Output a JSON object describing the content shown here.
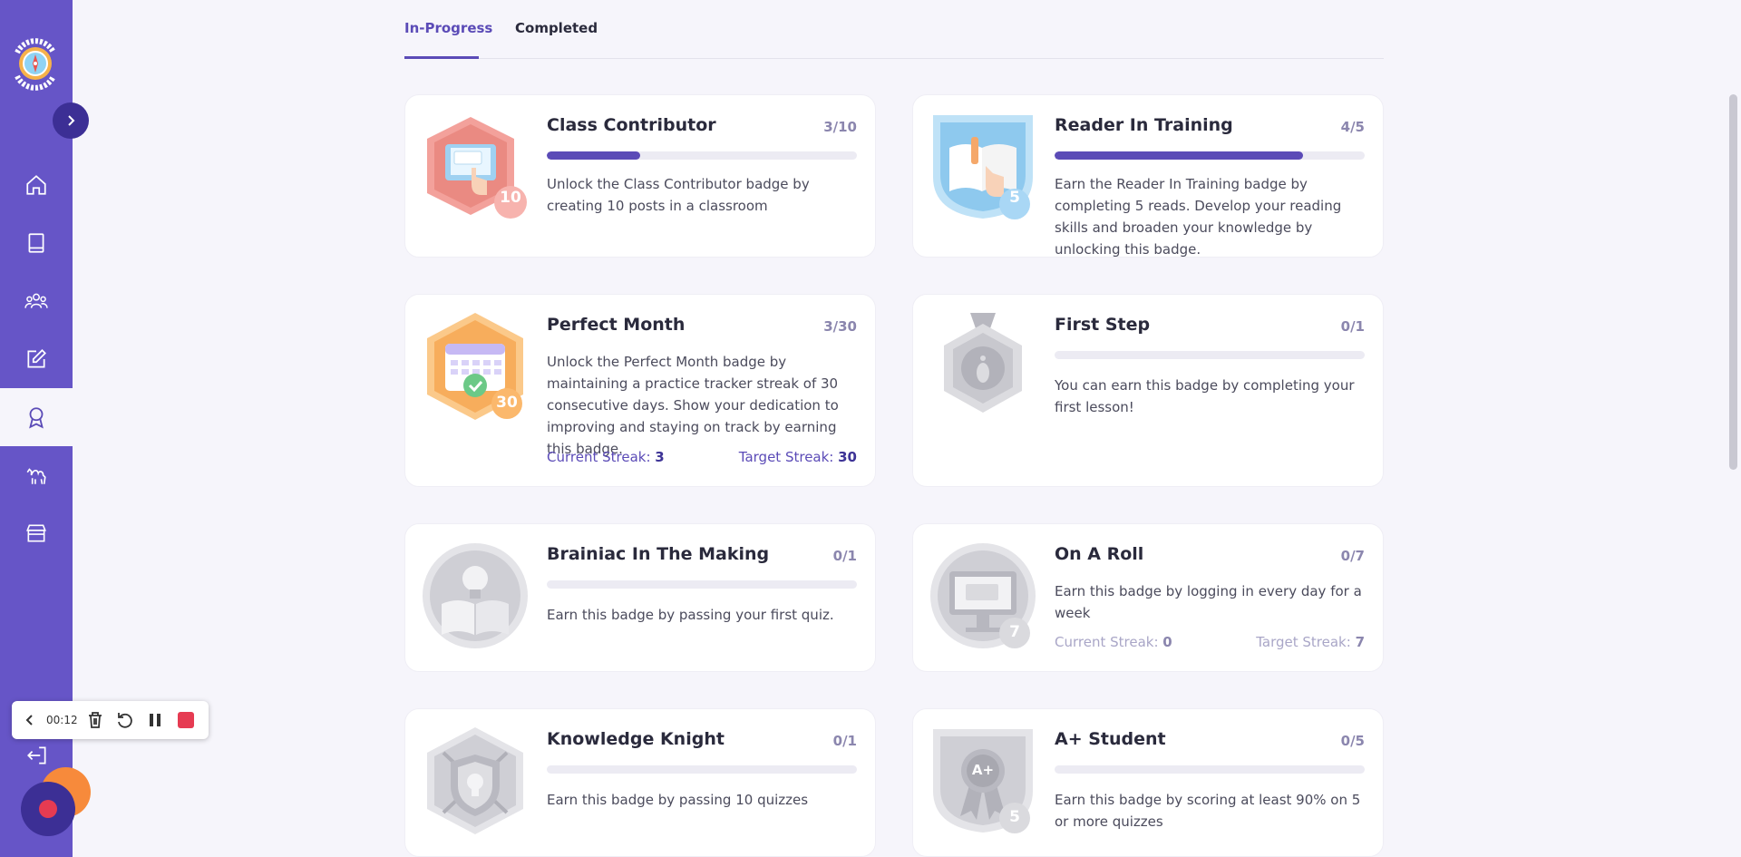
{
  "tabs": [
    {
      "label": "In-Progress"
    },
    {
      "label": "Completed"
    }
  ],
  "nav": {
    "items": [
      {
        "icon": "home-icon"
      },
      {
        "icon": "book-icon"
      },
      {
        "icon": "groups-icon"
      },
      {
        "icon": "edit-icon"
      },
      {
        "icon": "award-icon"
      },
      {
        "icon": "camel-icon"
      },
      {
        "icon": "store-icon"
      }
    ]
  },
  "badges": [
    {
      "title": "Class Contributor",
      "count": "3/10",
      "progress": 0.3,
      "desc": "Unlock the Class Contributor badge by creating 10 posts in a classroom",
      "badge_number": "10",
      "icon": "class-contributor-badge-icon"
    },
    {
      "title": "Reader In Training",
      "count": "4/5",
      "progress": 0.8,
      "desc": "Earn the Reader In Training badge by completing 5 reads. Develop your reading skills and broaden your knowledge by unlocking this badge.",
      "badge_number": "5",
      "icon": "reader-badge-icon"
    },
    {
      "title": "Perfect Month",
      "count": "3/30",
      "progress": 0.1,
      "desc": "Unlock the Perfect Month badge by maintaining a practice tracker streak of 30 consecutive days. Show your dedication to improving and staying on track by earning this badge.",
      "badge_number": "30",
      "icon": "calendar-badge-icon",
      "current_label": "Current Streak: ",
      "current_value": "3",
      "target_label": "Target Streak: ",
      "target_value": "30"
    },
    {
      "title": "First Step",
      "count": "0/1",
      "progress": 0,
      "desc": "You can earn this badge by completing your first lesson!",
      "icon": "footprint-badge-icon"
    },
    {
      "title": "Brainiac In The Making",
      "count": "0/1",
      "progress": 0,
      "desc": "Earn this badge by passing your first quiz.",
      "icon": "lightbulb-badge-icon"
    },
    {
      "title": "On A Roll",
      "count": "0/7",
      "progress": 0,
      "desc": "Earn this badge by logging in every day for a week",
      "badge_number": "7",
      "icon": "computer-badge-icon",
      "current_label": "Current Streak: ",
      "current_value": "0",
      "target_label": "Target Streak: ",
      "target_value": "7"
    },
    {
      "title": "Knowledge Knight",
      "count": "0/1",
      "progress": 0,
      "desc": "Earn this badge by passing 10 quizzes",
      "icon": "shield-badge-icon"
    },
    {
      "title": "A+ Student",
      "count": "0/5",
      "progress": 0,
      "desc": "Earn this badge by scoring at least 90% on 5 or more quizzes",
      "badge_number": "5",
      "badge_text": "A+",
      "icon": "ribbon-badge-icon"
    }
  ],
  "recorder": {
    "time": "00:12"
  },
  "colors": {
    "sidebar": "#6655c7",
    "accent": "#5b4bb7",
    "record": "#e63b52",
    "orange": "#f78a3b"
  }
}
